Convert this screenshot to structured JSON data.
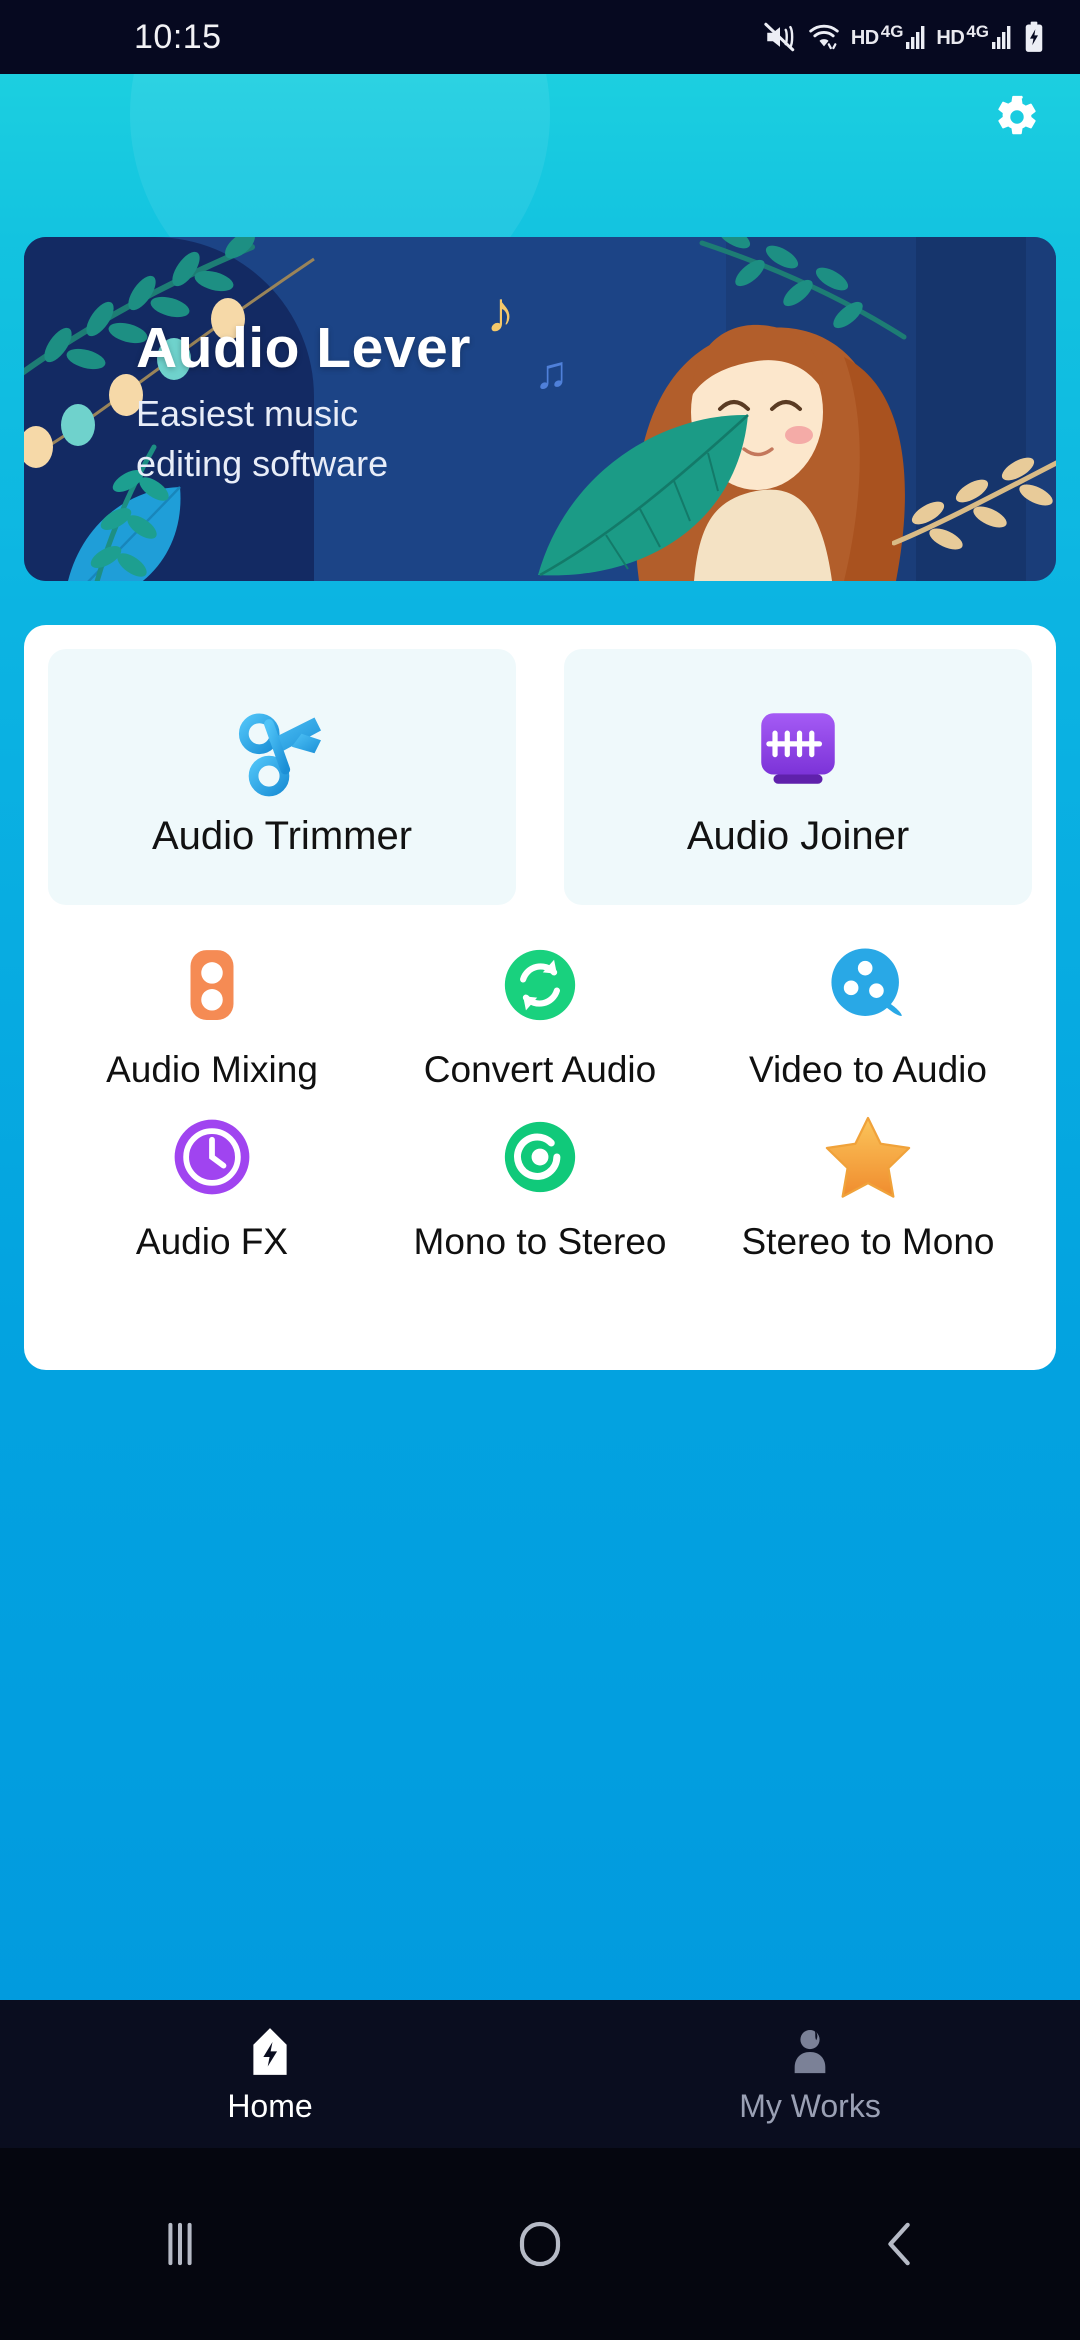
{
  "status_bar": {
    "time": "10:15",
    "hd_label_1": "HD",
    "network_1": "4G",
    "hd_label_2": "HD",
    "network_2": "4G",
    "icons": [
      "mute-icon",
      "wifi-icon",
      "signal-icon",
      "battery-charging-icon"
    ]
  },
  "header": {
    "settings_icon": "gear-icon"
  },
  "banner": {
    "title": "Audio Lever",
    "subtitle": "Easiest music\nediting software",
    "background_color": "#1c4486"
  },
  "tools": {
    "featured": [
      {
        "label": "Audio Trimmer",
        "icon": "scissors-icon",
        "color": "#2aa7e8"
      },
      {
        "label": "Audio Joiner",
        "icon": "joiner-icon",
        "color": "#9b4ded"
      }
    ],
    "grid": [
      {
        "label": "Audio Mixing",
        "icon": "mixer-icon",
        "color": "#f58b54"
      },
      {
        "label": "Convert Audio",
        "icon": "convert-icon",
        "color": "#19d17e"
      },
      {
        "label": "Video to Audio",
        "icon": "film-reel-icon",
        "color": "#29a8e6"
      },
      {
        "label": "Audio FX",
        "icon": "fx-clock-icon",
        "color": "#a044f0"
      },
      {
        "label": "Mono to Stereo",
        "icon": "mono-stereo-icon",
        "color": "#10c97a"
      },
      {
        "label": "Stereo to Mono",
        "icon": "star-icon",
        "color": "#f9a83a"
      }
    ]
  },
  "bottom_nav": {
    "items": [
      {
        "label": "Home",
        "icon": "bolt-home-icon",
        "active": true
      },
      {
        "label": "My Works",
        "icon": "person-icon",
        "active": false
      }
    ]
  },
  "system_nav": {
    "recents_icon": "recents-icon",
    "home_icon": "home-circle-icon",
    "back_icon": "back-chevron-icon"
  },
  "theme": {
    "accent": "#0cb4e2",
    "card_bg": "#ffffff",
    "tile_bg": "#eff9fb"
  }
}
